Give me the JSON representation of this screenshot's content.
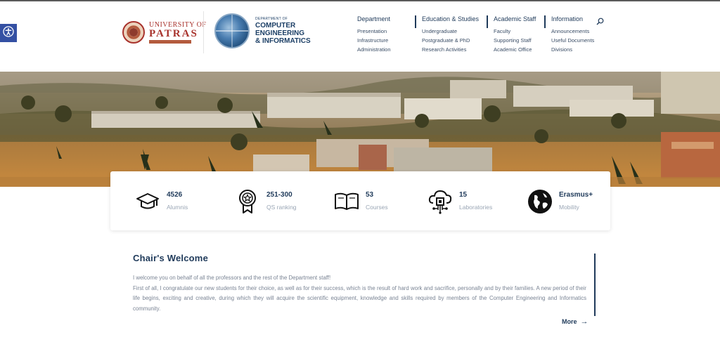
{
  "header": {
    "upatras_logo": {
      "line1": "UNIVERSITY OF",
      "line2": "PATRAS",
      "alt": "ΠΑΝΕΠΙΣΤΗΜΙΟ ΠΑΤΡΩΝ"
    },
    "ceid_logo": {
      "line1": "DEPARTMENT OF",
      "line2": "COMPUTER",
      "line3": "ENGINEERING",
      "line4": "& INFORMATICS"
    }
  },
  "nav": {
    "columns": [
      {
        "title": "Department",
        "items": [
          "Presentation",
          "Infrastructure",
          "Administration"
        ]
      },
      {
        "title": "Education & Studies",
        "items": [
          "Undergraduate",
          "Postgraduate & PhD",
          "Research Activities"
        ]
      },
      {
        "title": "Academic Staff",
        "items": [
          "Faculty",
          "Supporting Staff",
          "Academic Office"
        ]
      },
      {
        "title": "Information",
        "items": [
          "Announcements",
          "Useful Documents",
          "Divisions"
        ]
      }
    ],
    "search_icon": "search-icon"
  },
  "accessibility": {
    "icon": "accessibility-icon",
    "color": "#3450a3"
  },
  "stats": [
    {
      "value": "4526",
      "label": "Alumnis",
      "icon": "graduation-cap-icon"
    },
    {
      "value": "251-300",
      "label": "QS ranking",
      "icon": "award-badge-icon"
    },
    {
      "value": "53",
      "label": "Courses",
      "icon": "open-book-icon"
    },
    {
      "value": "15",
      "label": "Laboratories",
      "icon": "cloud-chip-icon"
    },
    {
      "value": "Erasmus+",
      "label": "Mobility",
      "icon": "globe-icon"
    }
  ],
  "welcome": {
    "title": "Chair's Welcome",
    "paragraph1": "I welcome you on behalf of all the professors and the rest of the Department staff!",
    "paragraph2": "First of all, I congratulate our new students for their choice, as well as for their success, which is the result of hard work and sacrifice, personally and by their families. A new period of their life begins, exciting and creative, during which they will acquire the scientific equipment, knowledge and skills required by members of the Computer Engineering and Informatics community.",
    "more_label": "More",
    "more_arrow": "→"
  },
  "colors": {
    "primary": "#1f3a5a",
    "muted": "#9aa6b5",
    "brand_red": "#a8322c"
  }
}
